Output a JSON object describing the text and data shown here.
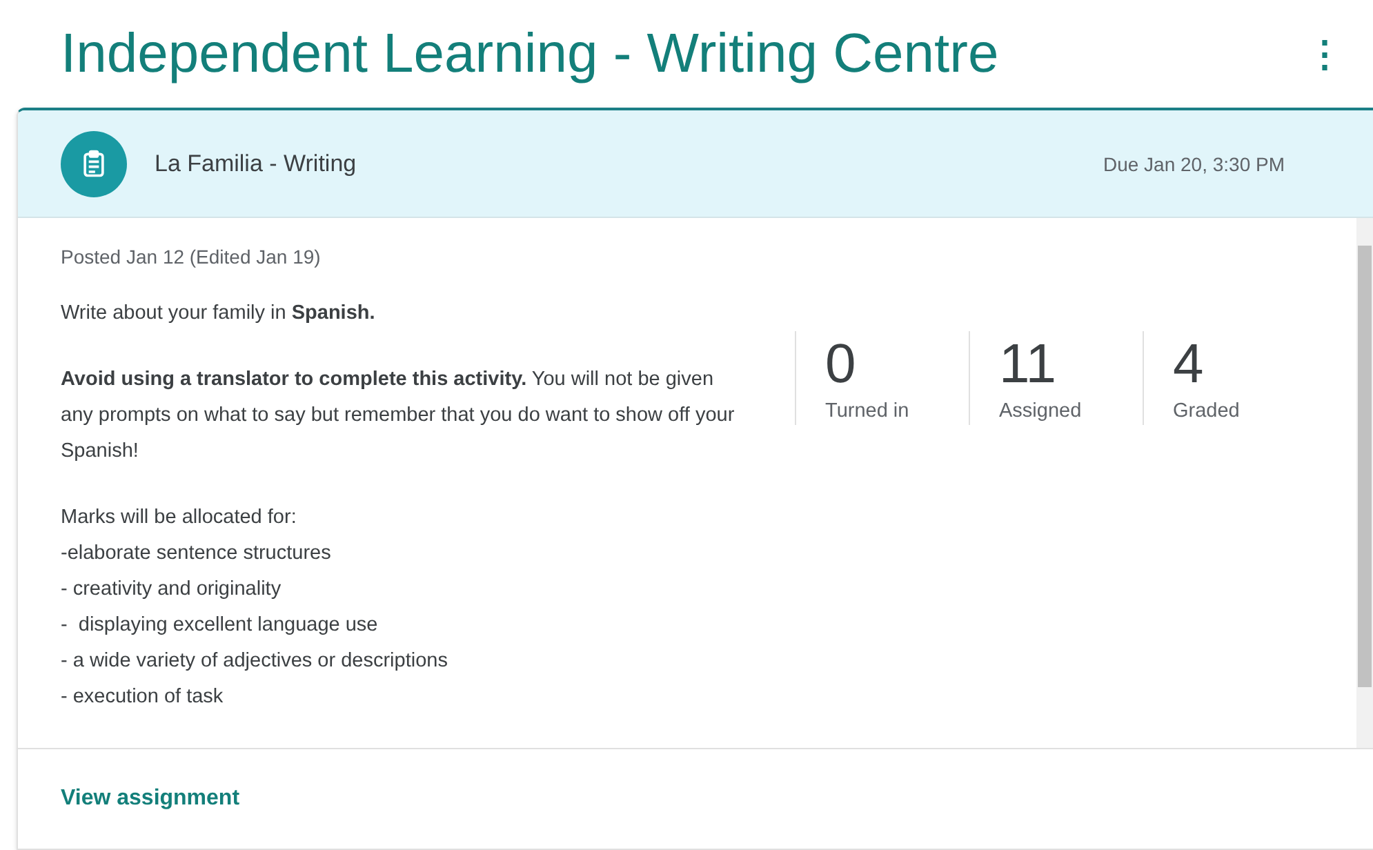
{
  "page": {
    "title": "Independent Learning - Writing Centre",
    "menu_icon": "⋮"
  },
  "assignment": {
    "title": "La Familia - Writing",
    "due": "Due Jan 20, 3:30 PM",
    "posted": "Posted Jan 12 (Edited Jan 19)",
    "paragraphs": [
      "Write about your family in **Spanish.**",
      "**Avoid using a translator to complete this activity.** You will not be given any prompts on what to say but remember that you do want to show off your Spanish!",
      "Marks will be allocated for:\n-elaborate sentence structures\n- creativity and originality\n-  displaying excellent language use\n- a wide variety of adjectives or descriptions\n- execution of task"
    ],
    "stats": [
      {
        "value": "0",
        "label": "Turned in"
      },
      {
        "value": "11",
        "label": "Assigned"
      },
      {
        "value": "4",
        "label": "Graded"
      }
    ],
    "link": "View assignment"
  }
}
